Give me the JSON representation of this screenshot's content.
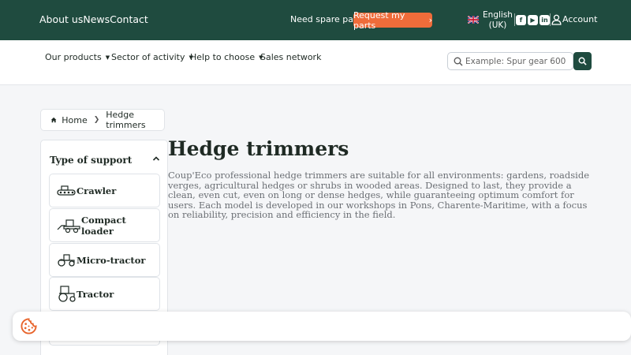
{
  "topbar": {
    "links": [
      "About us",
      "News",
      "Contact"
    ],
    "spare_text": "Need spare parts?",
    "request_button": "Request my parts",
    "language_line1": "English",
    "language_line2": "(UK)",
    "social": [
      "facebook-icon",
      "youtube-icon",
      "linkedin-icon"
    ],
    "account": "Account"
  },
  "nav": {
    "items": [
      {
        "label": "Our products"
      },
      {
        "label": "Sector of activity"
      },
      {
        "label": "Help to choose"
      },
      {
        "label": "Sales network"
      }
    ],
    "search_placeholder": "Example: Spur gear 600"
  },
  "breadcrumb": {
    "home": "Home",
    "current": "Hedge trimmers"
  },
  "filter": {
    "title": "Type of support",
    "options": [
      {
        "label": "Crawler",
        "icon": "crawler-icon"
      },
      {
        "label": "Compact loader",
        "icon": "compact-loader-icon"
      },
      {
        "label": "Micro-tractor",
        "icon": "micro-tractor-icon"
      },
      {
        "label": "Tractor",
        "icon": "tractor-icon"
      }
    ]
  },
  "main": {
    "title": "Hedge trimmers",
    "description": "Coup'Eco professional hedge trimmers are suitable for all environments: gardens, roadside verges, agricultural hedges or shrubs in wooded areas. Designed to last, they provide a clean, even cut, even on long or dense hedges, while guaranteeing optimum comfort for users. Each model is developed in our workshops in Pons, Charente-Maritime, with a focus on reliability, precision and efficiency in the field."
  },
  "colors": {
    "brand_green": "#1f4b3f",
    "accent_orange": "#ef6c3a",
    "cookie_orange": "#e8652d"
  }
}
